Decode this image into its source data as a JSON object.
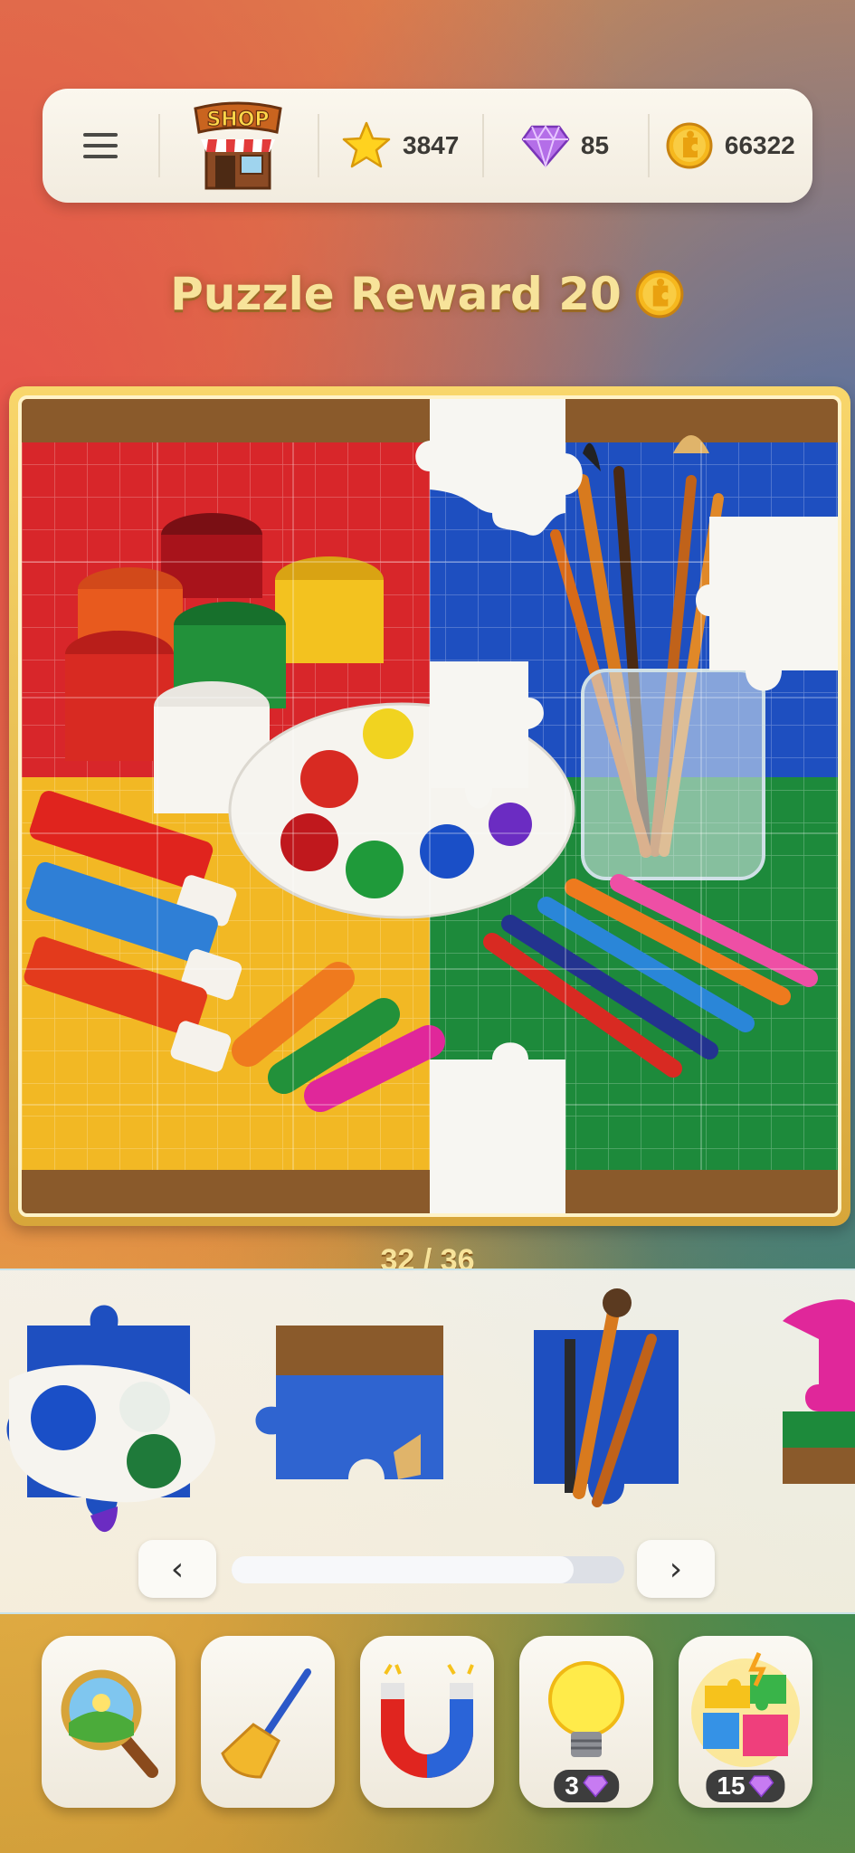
{
  "header": {
    "menu_icon": "hamburger-menu-icon",
    "shop_label": "SHOP",
    "stars": "3847",
    "gems": "85",
    "coins": "66322"
  },
  "title": {
    "text": "Puzzle Reward 20",
    "icon": "puzzle-coin-icon"
  },
  "board": {
    "image": "art supplies: paint jars, palette, paint tubes, brushes in glass jar, colored pencils, crayons",
    "colors": {
      "red": "#d8262a",
      "blue": "#1e4fc0",
      "yellow": "#f2b824",
      "green": "#1d8a3b",
      "wood": "#8a5a2b"
    }
  },
  "progress": {
    "text": "32 / 36",
    "placed": 32,
    "total": 36
  },
  "tray": {
    "pieces": [
      "palette-piece",
      "blue-wood-piece",
      "brushes-piece",
      "partial-piece"
    ],
    "scroll_left_icon": "chevron-left-icon",
    "scroll_right_icon": "chevron-right-icon",
    "scroll_position": 0.85
  },
  "tools": [
    {
      "name": "magnifier",
      "icon": "magnifier-icon"
    },
    {
      "name": "broom",
      "icon": "broom-icon"
    },
    {
      "name": "magnet",
      "icon": "magnet-icon"
    },
    {
      "name": "hint",
      "icon": "lightbulb-icon",
      "cost": "3"
    },
    {
      "name": "auto-complete",
      "icon": "puzzle-pieces-icon",
      "cost": "15"
    }
  ]
}
